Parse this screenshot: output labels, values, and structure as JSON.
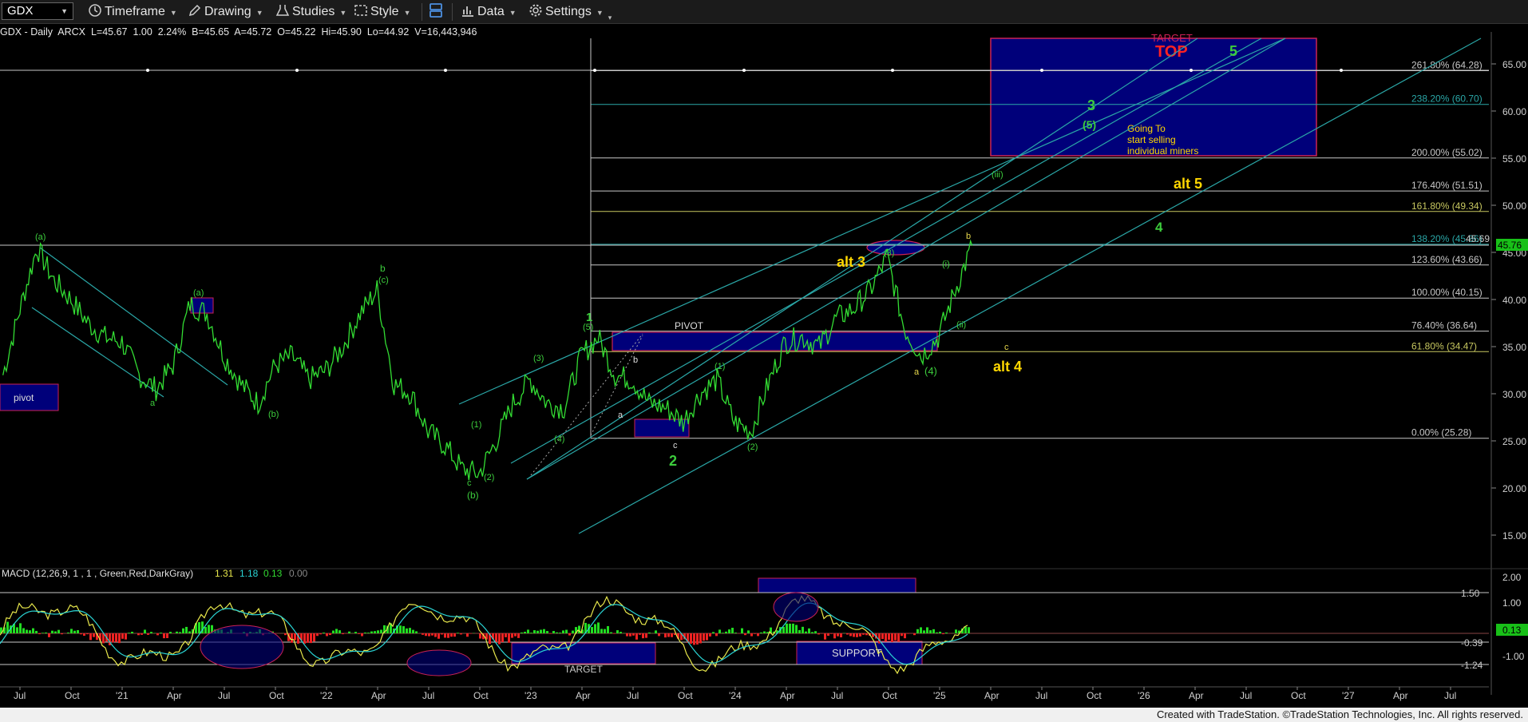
{
  "toolbar": {
    "symbol": "GDX",
    "items": [
      {
        "label": "Timeframe",
        "icon": "clock-icon"
      },
      {
        "label": "Drawing",
        "icon": "pencil-icon"
      },
      {
        "label": "Studies",
        "icon": "flask-icon"
      },
      {
        "label": "Style",
        "icon": "style-icon"
      },
      {
        "label": "",
        "icon": "layout-icon"
      },
      {
        "label": "Data",
        "icon": "bar-chart-icon"
      },
      {
        "label": "Settings",
        "icon": "gear-icon"
      }
    ]
  },
  "header": {
    "symbol": "GDX - Daily",
    "exchange": "ARCX",
    "last": "L=45.67",
    "change": "1.00",
    "change_pct": "2.24%",
    "bid": "B=45.65",
    "ask": "A=45.72",
    "open": "O=45.22",
    "high": "Hi=45.90",
    "low": "Lo=44.92",
    "volume": "V=16,443,946"
  },
  "price_axis": {
    "ticks": [
      "65.00",
      "60.00",
      "55.00",
      "50.00",
      "45.00",
      "40.00",
      "35.00",
      "30.00",
      "25.00",
      "20.00",
      "15.00"
    ],
    "last_price_tag": "45.76",
    "secondary_tag": "45.69"
  },
  "macd": {
    "label": "MACD (12,26,9, 1 , 1 , Green,Red,DarkGray)",
    "v1": "1.31",
    "v2": "1.18",
    "v3": "0.13",
    "v4": "0.00",
    "levels": [
      "1.50",
      "-0.39",
      "-1.24"
    ],
    "axis_ticks": [
      "2.00",
      "1.00",
      "-1.00"
    ],
    "current_tag": "0.13",
    "support_label": "SUPPORT",
    "target_label": "TARGET"
  },
  "fib_levels": [
    {
      "pct": "261.80%",
      "val": "64.28",
      "label": "261.80% (64.28)",
      "price": 64.28,
      "color": "#c8c8c8"
    },
    {
      "pct": "238.20%",
      "val": "60.70",
      "label": "238.20% (60.70)",
      "price": 60.7,
      "color": "#2aa7a7"
    },
    {
      "pct": "200.00%",
      "val": "55.02",
      "label": "200.00% (55.02)",
      "price": 55.02,
      "color": "#c8c8c8"
    },
    {
      "pct": "176.40%",
      "val": "51.51",
      "label": "176.40% (51.51)",
      "price": 51.51,
      "color": "#c8c8c8"
    },
    {
      "pct": "161.80%",
      "val": "49.34",
      "label": "161.80% (49.34)",
      "price": 49.34,
      "color": "#c8c860"
    },
    {
      "pct": "138.20%",
      "val": "45.86",
      "label": "138.20% (45.86)",
      "price": 45.86,
      "color": "#2aa7a7"
    },
    {
      "pct": "123.60%",
      "val": "43.66",
      "label": "123.60% (43.66)",
      "price": 43.66,
      "color": "#c8c8c8"
    },
    {
      "pct": "100.00%",
      "val": "40.15",
      "label": "100.00% (40.15)",
      "price": 40.15,
      "color": "#c8c8c8"
    },
    {
      "pct": "76.40%",
      "val": "36.64",
      "label": "76.40% (36.64)",
      "price": 36.64,
      "color": "#c8c8c8"
    },
    {
      "pct": "61.80%",
      "val": "34.47",
      "label": "61.80% (34.47)",
      "price": 34.47,
      "color": "#c8c860"
    },
    {
      "pct": "0.00%",
      "val": "25.28",
      "label": "0.00% (25.28)",
      "price": 25.28,
      "color": "#c8c8c8"
    }
  ],
  "annotations": {
    "target": "TARGET",
    "top": "TOP",
    "going_to_1": "Going To",
    "going_to_2": "start selling",
    "going_to_3": "individual miners",
    "pivot": "PIVOT",
    "pivot_box": "pivot",
    "alt3": "alt 3",
    "alt4": "alt 4",
    "alt5": "alt 5"
  },
  "wave_labels": [
    {
      "t": "(a)",
      "c": "#3ccc3c",
      "s": 11
    },
    {
      "t": "a",
      "c": "#3ccc3c",
      "s": 11
    },
    {
      "t": "(a)",
      "c": "#3ccc3c",
      "s": 11
    },
    {
      "t": "(b)",
      "c": "#3ccc3c",
      "s": 11
    },
    {
      "t": "b",
      "c": "#3ccc3c",
      "s": 12
    },
    {
      "t": "(c)",
      "c": "#3ccc3c",
      "s": 11
    },
    {
      "t": "c",
      "c": "#3ccc3c",
      "s": 11
    },
    {
      "t": "(b)",
      "c": "#3ccc3c",
      "s": 12
    },
    {
      "t": "(1)",
      "c": "#3ccc3c",
      "s": 11
    },
    {
      "t": "(2)",
      "c": "#3ccc3c",
      "s": 11
    },
    {
      "t": "(3)",
      "c": "#3ccc3c",
      "s": 11
    },
    {
      "t": "(4)",
      "c": "#3ccc3c",
      "s": 11
    },
    {
      "t": "(5)",
      "c": "#3ccc3c",
      "s": 11
    },
    {
      "t": "1",
      "c": "#3ccc3c",
      "s": 15
    },
    {
      "t": "a",
      "c": "#dddddd",
      "s": 11
    },
    {
      "t": "b",
      "c": "#dddddd",
      "s": 11
    },
    {
      "t": "c",
      "c": "#dddddd",
      "s": 11
    },
    {
      "t": "2",
      "c": "#3ccc3c",
      "s": 18
    },
    {
      "t": "(1)",
      "c": "#3ccc3c",
      "s": 11
    },
    {
      "t": "(2)",
      "c": "#3ccc3c",
      "s": 11
    },
    {
      "t": "(3)",
      "c": "#3ccc3c",
      "s": 11
    },
    {
      "t": "a",
      "c": "#e8d84c",
      "s": 11
    },
    {
      "t": "(4)",
      "c": "#3ccc3c",
      "s": 13
    },
    {
      "t": "(i)",
      "c": "#3ccc3c",
      "s": 11
    },
    {
      "t": "(ii)",
      "c": "#3ccc3c",
      "s": 11
    },
    {
      "t": "b",
      "c": "#e8d84c",
      "s": 11
    },
    {
      "t": "c",
      "c": "#e8d84c",
      "s": 11
    },
    {
      "t": "(iii)",
      "c": "#3ccc3c",
      "s": 11
    },
    {
      "t": "3",
      "c": "#3ccc3c",
      "s": 18
    },
    {
      "t": "(5)",
      "c": "#3ccc3c",
      "s": 14
    },
    {
      "t": "4",
      "c": "#3ccc3c",
      "s": 17
    },
    {
      "t": "5",
      "c": "#3ccc3c",
      "s": 18
    }
  ],
  "time_axis": [
    "Jul",
    "Oct",
    "'21",
    "Apr",
    "Jul",
    "Oct",
    "'22",
    "Apr",
    "Jul",
    "Oct",
    "'23",
    "Apr",
    "Jul",
    "Oct",
    "'24",
    "Apr",
    "Jul",
    "Oct",
    "'25",
    "Apr",
    "Jul",
    "Oct",
    "'26",
    "Apr",
    "Jul",
    "Oct",
    "'27",
    "Apr",
    "Jul"
  ],
  "price_path": [
    [
      "2020-06",
      32.0
    ],
    [
      "2020-07",
      39.0
    ],
    [
      "2020-08",
      45.5
    ],
    [
      "2020-09",
      42.0
    ],
    [
      "2020-10",
      40.0
    ],
    [
      "2020-11",
      37.5
    ],
    [
      "2020-12",
      36.0
    ],
    [
      "2021-01",
      35.5
    ],
    [
      "2021-02",
      32.0
    ],
    [
      "2021-03",
      30.5
    ],
    [
      "2021-04",
      33.0
    ],
    [
      "2021-05",
      39.5
    ],
    [
      "2021-06",
      38.5
    ],
    [
      "2021-07",
      34.0
    ],
    [
      "2021-08",
      31.0
    ],
    [
      "2021-09",
      29.0
    ],
    [
      "2021-10",
      33.0
    ],
    [
      "2021-11",
      34.0
    ],
    [
      "2021-12",
      31.5
    ],
    [
      "2022-01",
      32.5
    ],
    [
      "2022-02",
      35.0
    ],
    [
      "2022-03",
      38.5
    ],
    [
      "2022-04",
      41.0
    ],
    [
      "2022-05",
      31.0
    ],
    [
      "2022-06",
      30.0
    ],
    [
      "2022-07",
      26.0
    ],
    [
      "2022-08",
      24.5
    ],
    [
      "2022-09",
      22.0
    ],
    [
      "2022-10",
      21.5
    ],
    [
      "2022-11",
      25.0
    ],
    [
      "2022-12",
      29.0
    ],
    [
      "2023-01",
      31.5
    ],
    [
      "2023-02",
      29.0
    ],
    [
      "2023-03",
      28.5
    ],
    [
      "2023-04",
      34.0
    ],
    [
      "2023-05",
      36.0
    ],
    [
      "2023-06",
      32.0
    ],
    [
      "2023-07",
      31.5
    ],
    [
      "2023-08",
      29.0
    ],
    [
      "2023-09",
      28.5
    ],
    [
      "2023-10",
      27.0
    ],
    [
      "2023-11",
      30.0
    ],
    [
      "2023-12",
      31.5
    ],
    [
      "2024-01",
      27.0
    ],
    [
      "2024-02",
      26.0
    ],
    [
      "2024-03",
      31.0
    ],
    [
      "2024-04",
      35.5
    ],
    [
      "2024-05",
      36.0
    ],
    [
      "2024-06",
      35.0
    ],
    [
      "2024-07",
      38.0
    ],
    [
      "2024-08",
      39.0
    ],
    [
      "2024-09",
      41.0
    ],
    [
      "2024-10",
      44.5
    ],
    [
      "2024-11",
      37.0
    ],
    [
      "2024-12",
      34.0
    ],
    [
      "2025-01",
      36.0
    ],
    [
      "2025-02",
      41.0
    ],
    [
      "2025-03",
      45.7
    ]
  ],
  "footer": "Created with TradeStation. ©TradeStation Technologies, Inc. All rights reserved.",
  "colors": {
    "price": "#33dd33",
    "channel": "#2aa7a7",
    "box_fill": "#000080",
    "box_border": "#cc2255",
    "yellow": "#ffd700",
    "red": "#ff2222"
  }
}
